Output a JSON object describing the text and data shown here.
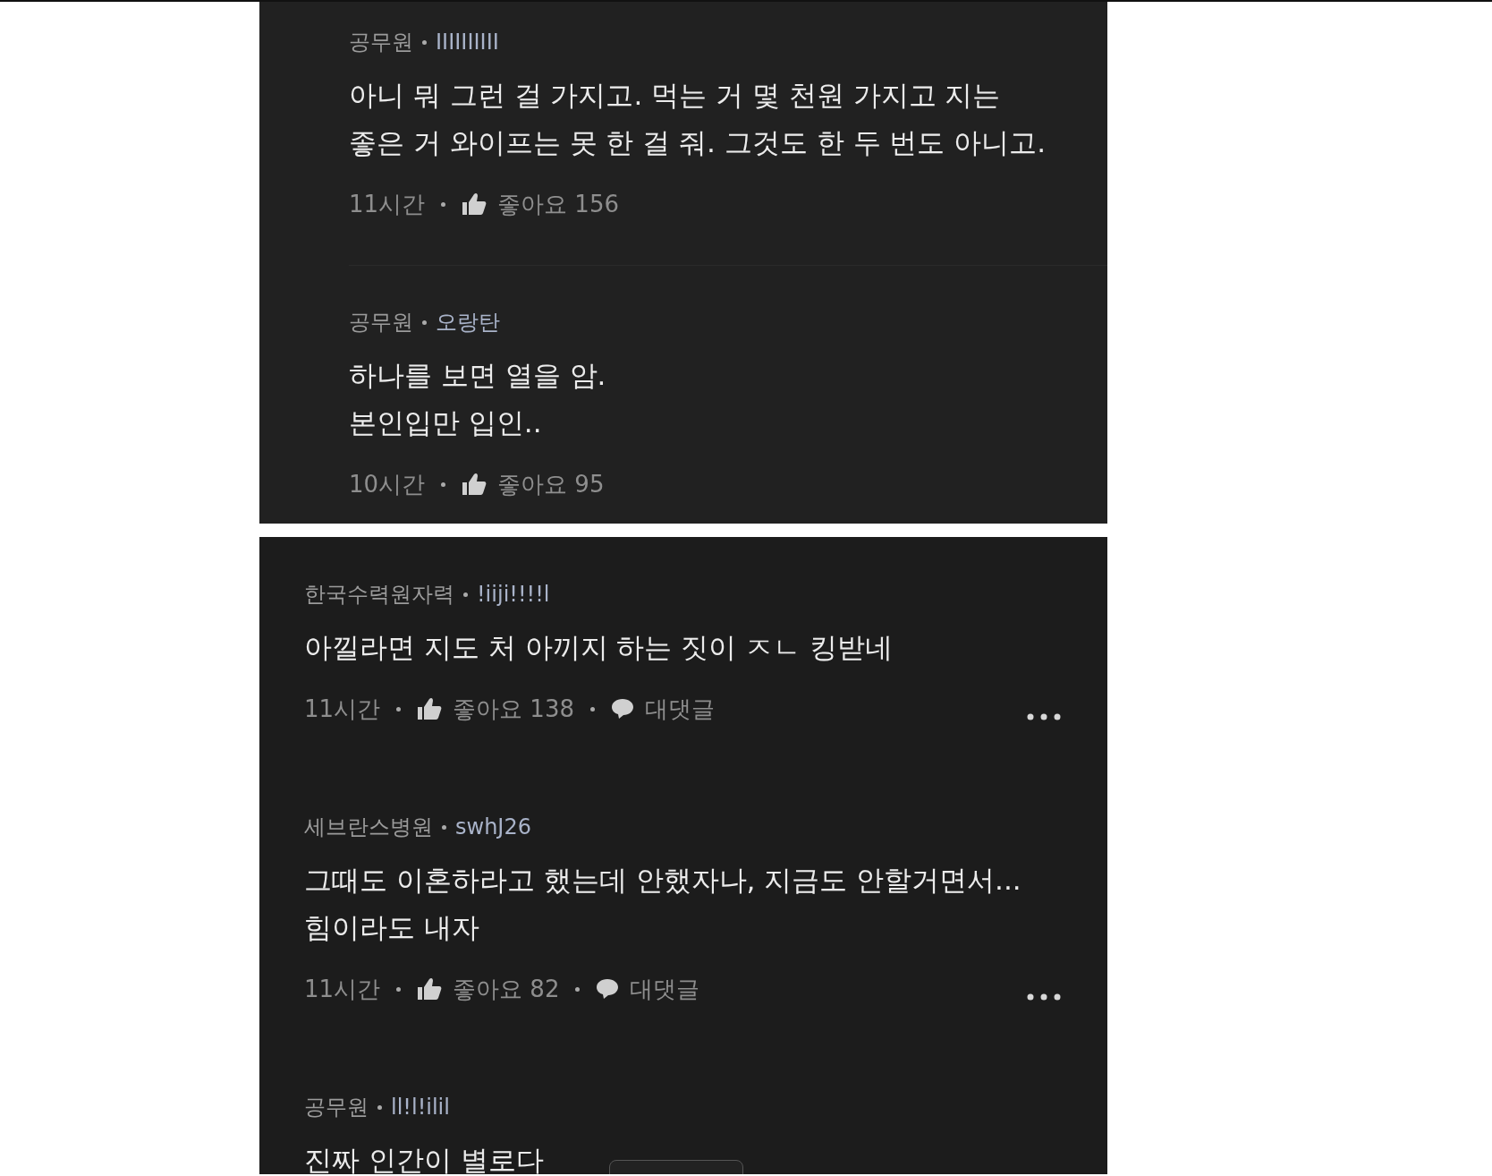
{
  "panels": [
    {
      "kind": "replies",
      "comments": [
        {
          "org": "공무원",
          "user": "IIIIIIIIII",
          "lines": [
            "아니 뭐 그런 걸 가지고. 먹는 거 몇 천원 가지고 지는",
            "좋은 거 와이프는 못 한 걸 줘. 그것도 한 두 번도 아니고."
          ],
          "time": "11시간",
          "likes": "좋아요 156",
          "menu": false
        },
        {
          "org": "공무원",
          "user": "오랑탄",
          "lines": [
            "하나를 보면 열을 암.",
            "본인입만 입인.."
          ],
          "time": "10시간",
          "likes": "좋아요 95",
          "menu": false
        }
      ]
    },
    {
      "kind": "comments",
      "floating_tab": true,
      "comments": [
        {
          "org": "한국수력원자력",
          "user": "!iiji!!!!l",
          "lines": [
            "아낄라면 지도 처 아끼지 하는 짓이 ㅈㄴ 킹받네"
          ],
          "time": "11시간",
          "likes": "좋아요 138",
          "reply": "대댓글",
          "menu": true
        },
        {
          "org": "세브란스병원",
          "user": "swhJ26",
          "lines": [
            "그때도 이혼하라고 했는데 안했자나, 지금도 안할거면서...",
            "힘이라도 내자"
          ],
          "time": "11시간",
          "likes": "좋아요 82",
          "reply": "대댓글",
          "menu": true
        },
        {
          "org": "공무원",
          "user": "ll!l!ilil",
          "lines": [
            "진짜 인간이 별로다"
          ],
          "menu": false
        }
      ]
    }
  ]
}
